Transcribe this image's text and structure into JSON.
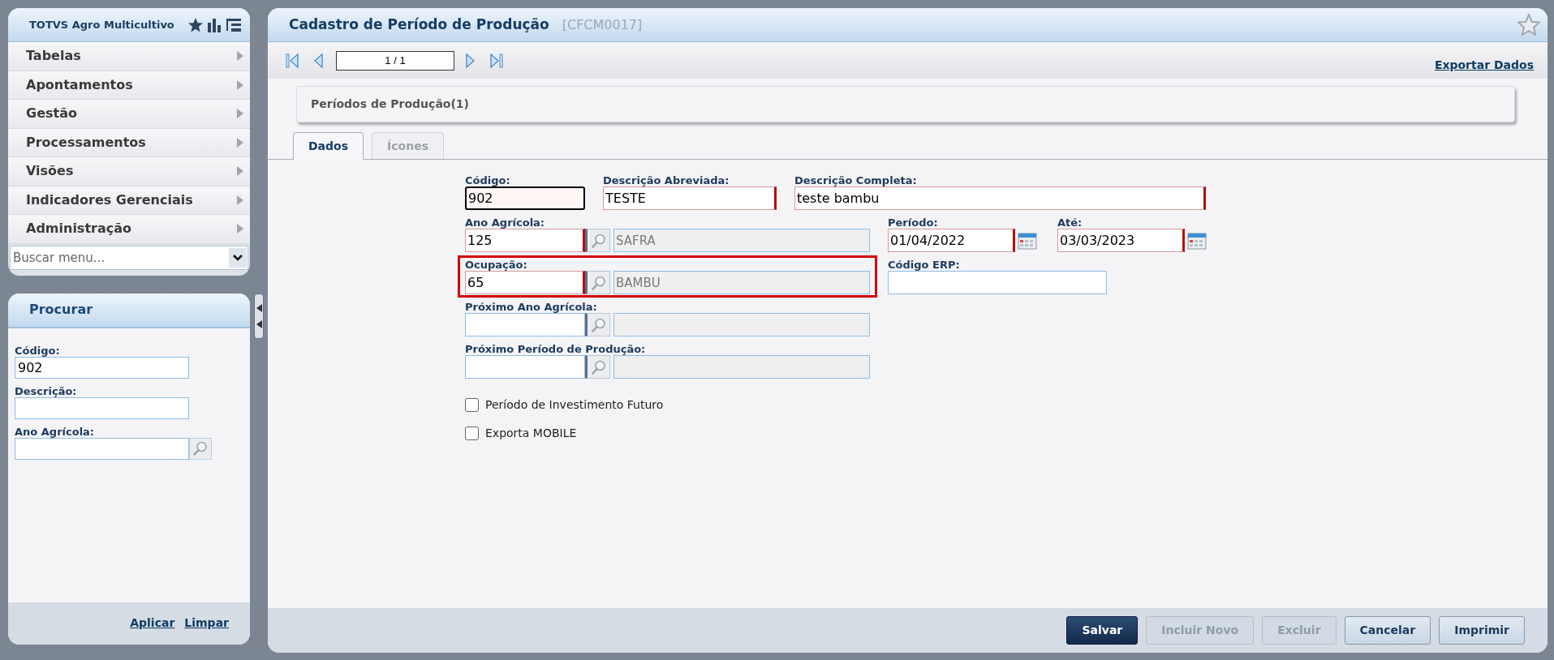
{
  "sidebar": {
    "title": "TOTVS Agro Multicultivo",
    "menu": [
      {
        "label": "Tabelas"
      },
      {
        "label": "Apontamentos"
      },
      {
        "label": "Gestão"
      },
      {
        "label": "Processamentos"
      },
      {
        "label": "Visões"
      },
      {
        "label": "Indicadores Gerenciais"
      },
      {
        "label": "Administração"
      }
    ],
    "menu_search": {
      "placeholder": "Buscar menu..."
    }
  },
  "search_panel": {
    "title": "Procurar",
    "fields": [
      {
        "kind": "text",
        "label": "Código:",
        "value": "902"
      },
      {
        "kind": "text",
        "label": "Descrição:"
      },
      {
        "kind": "lookup",
        "label": "Ano Agrícola:"
      }
    ],
    "links": [
      "Aplicar",
      "Limpar"
    ]
  },
  "main": {
    "title": "Cadastro de Período de Produção",
    "code": "[CFCM0017]",
    "pager": {
      "value": "1 / 1"
    },
    "export_link": "Exportar Dados",
    "summary": "Períodos de Produção(1)",
    "tabs": [
      {
        "label": "Dados",
        "selected": true,
        "disabled": false
      },
      {
        "label": "Ícones",
        "selected": false,
        "disabled": true
      }
    ],
    "form_rows": [
      [
        {
          "kind": "text",
          "label": "Código:",
          "value": "902",
          "required": true,
          "focused": true
        },
        {
          "kind": "text",
          "label": "Descrição Abreviada:",
          "value": "TESTE",
          "required": true,
          "focused": false
        },
        {
          "kind": "text",
          "label": "Descrição Completa:",
          "value": "teste bambu",
          "required": true,
          "focused": false
        }
      ],
      [
        {
          "kind": "lookup",
          "label": "Ano Agrícola:",
          "value": "125",
          "required": true,
          "focused": false,
          "highlighted": false,
          "description": {
            "value": "SAFRA",
            "disabled": true
          }
        },
        {
          "kind": "date",
          "label": "Período:",
          "value": "01/04/2022",
          "required": true,
          "focused": false
        },
        {
          "kind": "date",
          "label": "Até:",
          "value": "03/03/2023",
          "required": true,
          "focused": false
        }
      ],
      [
        {
          "kind": "lookup",
          "label": "Ocupação:",
          "value": "65",
          "required": true,
          "focused": false,
          "highlighted": true,
          "description": {
            "value": "BAMBU",
            "disabled": true
          }
        },
        {
          "kind": "text",
          "label": "Código ERP:",
          "required": false,
          "focused": false
        }
      ],
      [
        {
          "kind": "lookup",
          "label": "Próximo Ano Agrícola:",
          "required": false,
          "focused": false,
          "highlighted": false,
          "description": {
            "disabled": true
          }
        }
      ],
      [
        {
          "kind": "lookup",
          "label": "Próximo Período de Produção:",
          "required": false,
          "focused": false,
          "highlighted": false,
          "description": {
            "disabled": true
          }
        }
      ]
    ],
    "checkboxes": [
      {
        "label": "Período de Investimento Futuro",
        "checked": false
      },
      {
        "label": "Exporta MOBILE",
        "checked": false
      }
    ],
    "buttons": [
      {
        "label": "Salvar",
        "primary": true,
        "disabled": false
      },
      {
        "label": "Incluir Novo",
        "primary": false,
        "disabled": true
      },
      {
        "label": "Excluir",
        "primary": false,
        "disabled": true
      },
      {
        "label": "Cancelar",
        "primary": false,
        "disabled": false
      },
      {
        "label": "Imprimir",
        "primary": false,
        "disabled": false
      }
    ]
  }
}
